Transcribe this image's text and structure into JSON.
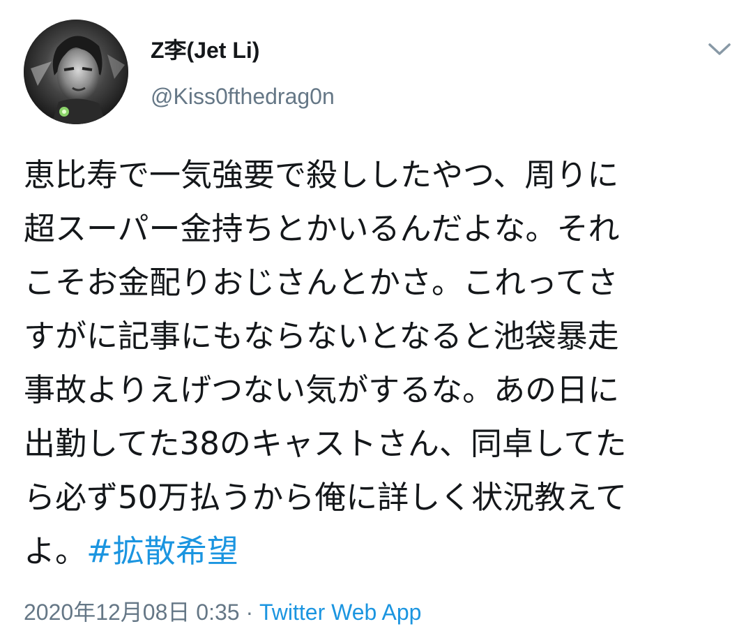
{
  "author": {
    "display_name": "Z李(Jet Li)",
    "handle": "@Kiss0fthedrag0n",
    "avatar_icon": "user-avatar-icon"
  },
  "menu": {
    "icon": "chevron-down-icon"
  },
  "tweet": {
    "lines": [
      "恵比寿で一気強要で殺ししたやつ、周りに",
      "超スーパー金持ちとかいるんだよな。それ",
      "こそお金配りおじさんとかさ。これってさ",
      "すがに記事にもならないとなると池袋暴走",
      "事故よりえげつない気がするな。あの日に",
      "出勤してた38のキャストさん、同卓してた",
      "ら必ず50万払うから俺に詳しく状況教えて"
    ],
    "last_line_text": "よ。",
    "hashtag": "#拡散希望"
  },
  "meta": {
    "timestamp": "2020年12月08日 0:35",
    "separator": " · ",
    "source": "Twitter Web App"
  },
  "colors": {
    "text": "#14171a",
    "secondary": "#657786",
    "link": "#1b95e0"
  }
}
